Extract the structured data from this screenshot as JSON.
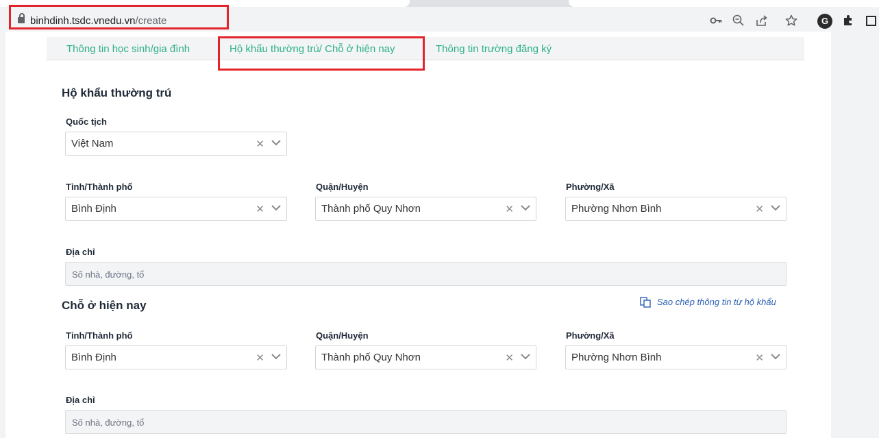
{
  "browser": {
    "url_domain": "binhdinh.tsdc.vnedu.vn",
    "url_path": "/create",
    "toolbar_icons": [
      "key-icon",
      "zoom-icon",
      "share-icon",
      "star-icon",
      "extension-icon",
      "puzzle-icon",
      "window-icon"
    ]
  },
  "tabs": [
    {
      "label": "Thông tin học sinh/gia đình"
    },
    {
      "label": "Hộ khẩu thường trú/ Chỗ ở hiện nay"
    },
    {
      "label": "Thông tin trường đăng ký"
    }
  ],
  "permanent": {
    "title": "Hộ khẩu thường trú",
    "nationality_label": "Quốc tịch",
    "nationality_value": "Việt Nam",
    "province_label": "Tỉnh/Thành phố",
    "province_value": "Bình Định",
    "district_label": "Quận/Huyện",
    "district_value": "Thành phố Quy Nhơn",
    "ward_label": "Phường/Xã",
    "ward_value": "Phường Nhơn Bình",
    "address_label": "Địa chỉ",
    "address_placeholder": "Số nhà, đường, tổ"
  },
  "current": {
    "title": "Chỗ ở hiện nay",
    "copy_link": "Sao chép thông tin từ hộ khẩu",
    "province_label": "Tỉnh/Thành phố",
    "province_value": "Bình Định",
    "district_label": "Quận/Huyện",
    "district_value": "Thành phố Quy Nhơn",
    "ward_label": "Phường/Xã",
    "ward_value": "Phường Nhơn Bình",
    "address_label": "Địa chỉ",
    "address_placeholder": "Số nhà, đường, tổ"
  },
  "colors": {
    "accent_tab": "#2db08a",
    "highlight_box": "#e3232a",
    "link": "#2a5fb3"
  }
}
